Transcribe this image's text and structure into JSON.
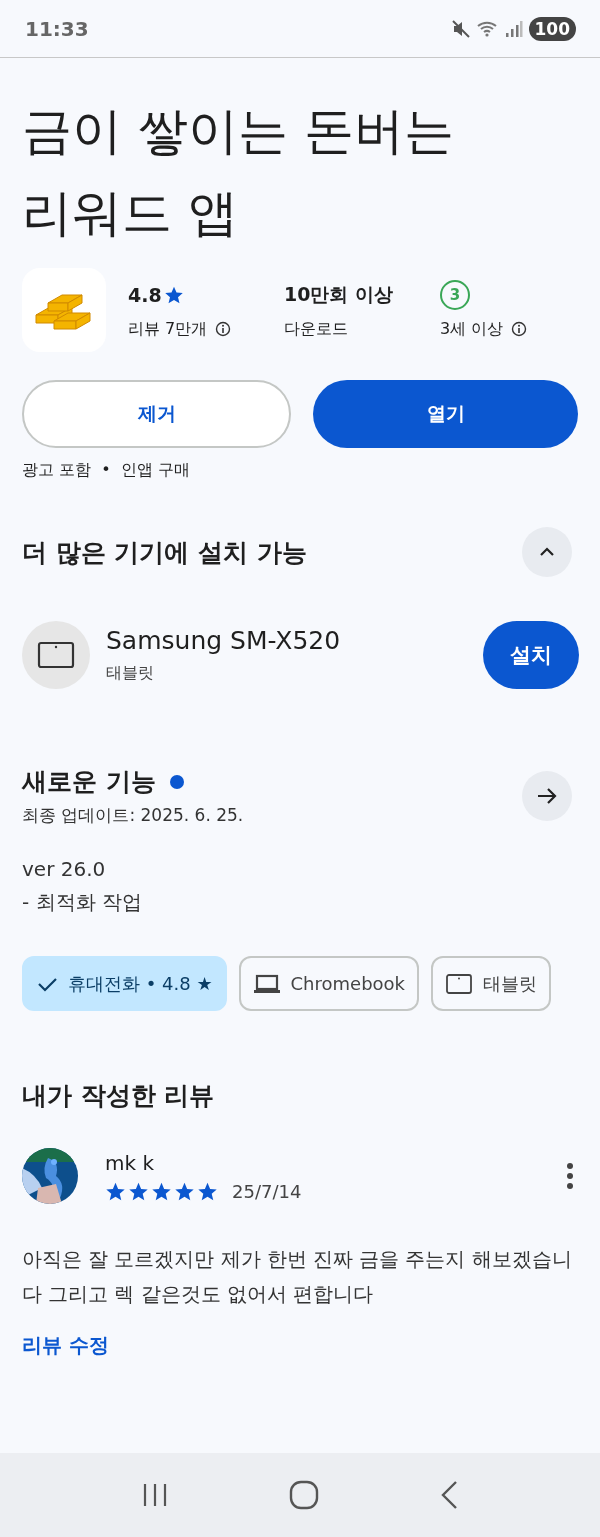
{
  "status_bar": {
    "time": "11:33",
    "battery": "100"
  },
  "title_lines": [
    "금이 쌓이는 돈버는",
    "리워드 앱"
  ],
  "stats": [
    {
      "kind": "rating",
      "value": "4.8",
      "label": "리뷰 7만개",
      "info": true
    },
    {
      "kind": "text",
      "value": "10만회 이상",
      "label": "다운로드",
      "info": false
    },
    {
      "kind": "age",
      "value": "3",
      "label": "3세 이상",
      "info": true
    }
  ],
  "actions": {
    "uninstall": "제거",
    "open": "열기"
  },
  "notes": "광고 포함  •  인앱 구매",
  "devices_section": {
    "title": "더 많은 기기에 설치 가능",
    "expanded": true,
    "device": {
      "name": "Samsung SM-X520",
      "type": "태블릿",
      "install": "설치"
    }
  },
  "whats_new": {
    "title": "새로운 기능",
    "unread": true,
    "updated": "최종 업데이트: 2025. 6. 25.",
    "lines": [
      "ver 26.0",
      "- 최적화 작업"
    ]
  },
  "device_tabs": [
    {
      "label": "휴대전화 • 4.8 ★",
      "selected": true
    },
    {
      "kind": "laptop",
      "label": "Chromebook",
      "selected": false
    },
    {
      "kind": "tablet",
      "label": "태블릿",
      "selected": false
    }
  ],
  "my_review": {
    "title": "내가 작성한 리뷰",
    "author": "mk k",
    "stars": 5,
    "date": "25/7/14",
    "text": "아직은 잘 모르겠지만 제가 한번 진짜 금을 주는지 해보겠습니다 그리고 렉 같은것도 없어서 편합니다",
    "edit": "리뷰 수정"
  }
}
